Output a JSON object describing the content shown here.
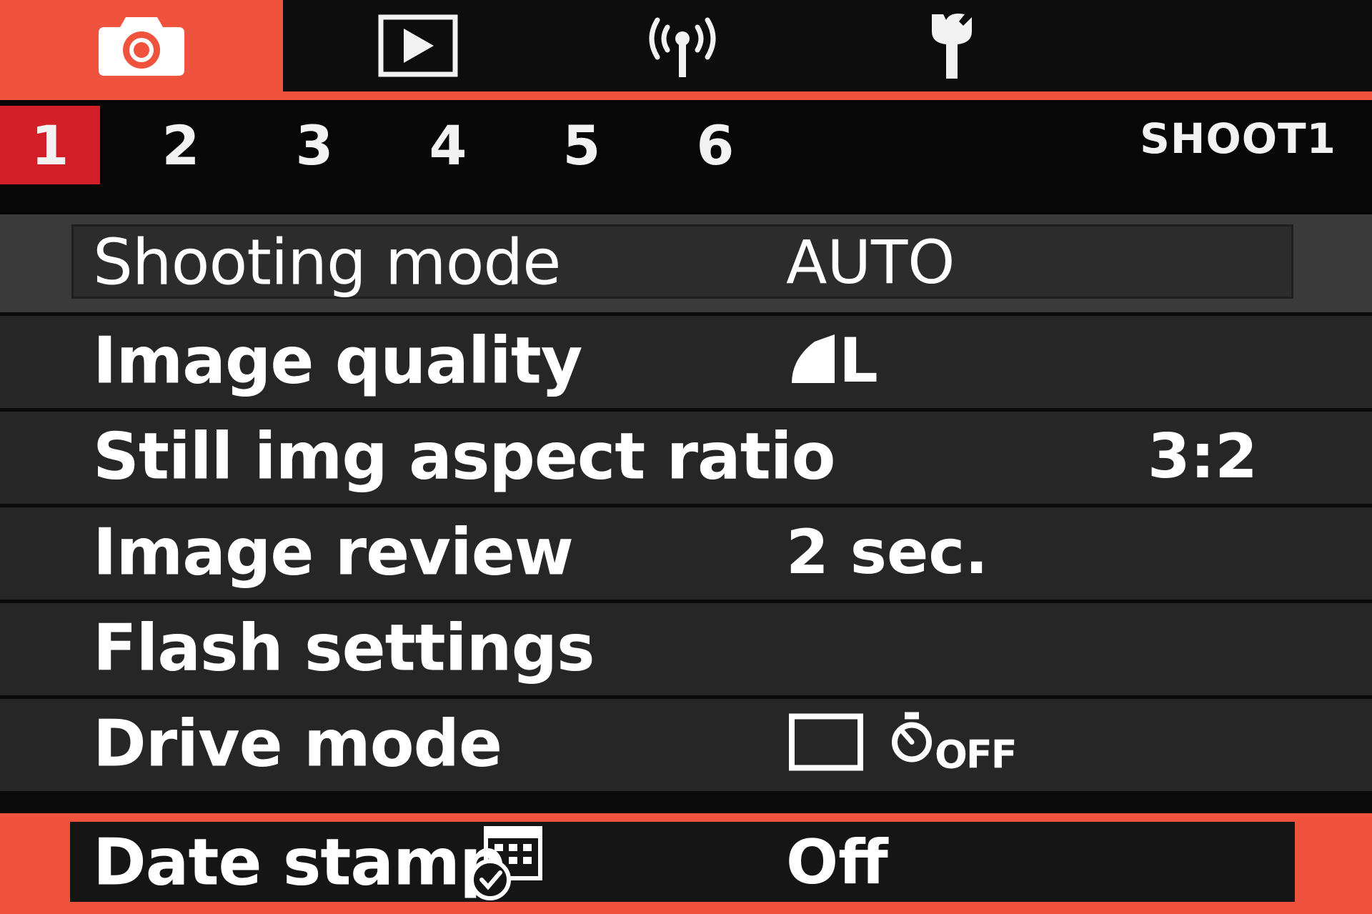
{
  "category_tabs": [
    {
      "icon": "camera-icon",
      "active": true
    },
    {
      "icon": "playback-icon",
      "active": false
    },
    {
      "icon": "wireless-icon",
      "active": false
    },
    {
      "icon": "wrench-icon",
      "active": false
    }
  ],
  "sub_tabs": [
    "1",
    "2",
    "3",
    "4",
    "5",
    "6"
  ],
  "active_sub_tab": "1",
  "page_name": "SHOOT1",
  "menu": {
    "shooting_mode": {
      "label": "Shooting mode",
      "value": "AUTO"
    },
    "image_quality": {
      "label": "Image quality",
      "value": "L",
      "value_icon": "quality-fine-icon"
    },
    "aspect_ratio": {
      "label": "Still img aspect ratio",
      "value": "3:2"
    },
    "image_review": {
      "label": "Image review",
      "value": "2 sec."
    },
    "flash_settings": {
      "label": "Flash settings"
    },
    "drive_mode": {
      "label": "Drive mode",
      "value_icons": [
        "single-shot-icon",
        "self-timer-off-icon"
      ],
      "timer_text": "OFF"
    },
    "date_stamp": {
      "label": "Date stamp",
      "label_icon": "date-stamp-icon",
      "value": "Off"
    }
  },
  "colors": {
    "accent": "#f0533d",
    "active_number": "#d21f27",
    "row_bg": "#262626"
  }
}
